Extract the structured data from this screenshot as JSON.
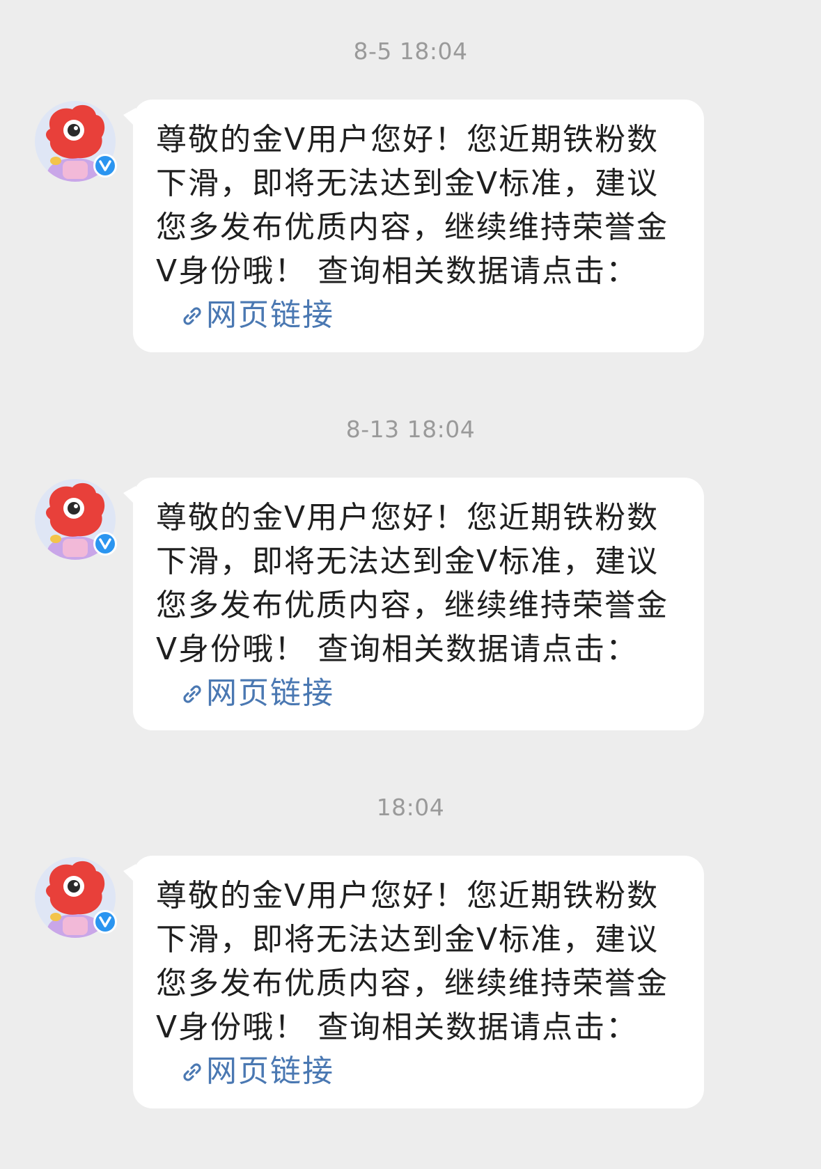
{
  "messages": [
    {
      "timestamp": "8-5 18:04",
      "text": "尊敬的金V用户您好！您近期铁粉数下滑，即将无法达到金V标准，建议您多发布优质内容，继续维持荣誉金V身份哦！ 查询相关数据请点击：",
      "link_label": "网页链接"
    },
    {
      "timestamp": "8-13 18:04",
      "text": "尊敬的金V用户您好！您近期铁粉数下滑，即将无法达到金V标准，建议您多发布优质内容，继续维持荣誉金V身份哦！ 查询相关数据请点击：",
      "link_label": "网页链接"
    },
    {
      "timestamp": "18:04",
      "text": "尊敬的金V用户您好！您近期铁粉数下滑，即将无法达到金V标准，建议您多发布优质内容，继续维持荣誉金V身份哦！ 查询相关数据请点击：",
      "link_label": "网页链接"
    }
  ],
  "colors": {
    "background": "#ededed",
    "bubble": "#ffffff",
    "link": "#4a78b2",
    "timestamp": "#9a9a9a",
    "verified": "#2b95f0",
    "mascot": "#e8403a"
  },
  "icons": {
    "avatar": "weibo-mascot-icon",
    "badge": "verified-v-icon",
    "link": "link-icon"
  }
}
